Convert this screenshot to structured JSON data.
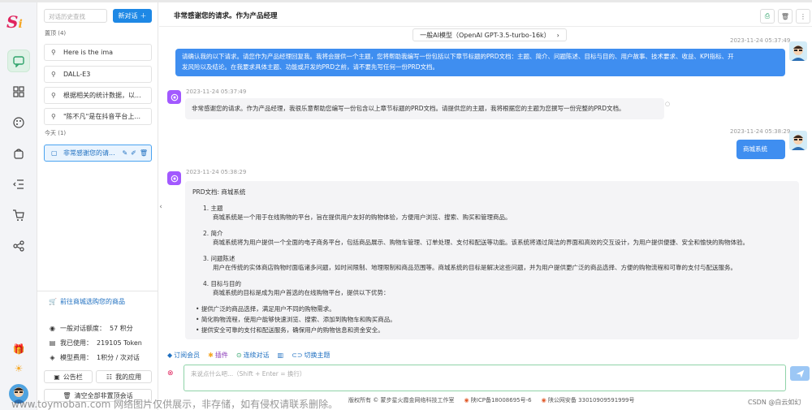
{
  "sidebar": {
    "search_placeholder": "对话历史查找",
    "new_chat_label": "新对话",
    "pinned_title": "置顶",
    "pinned_count": "(4)",
    "pinned_items": [
      "Here is the ima",
      "DALL-E3",
      "根据相关的统计数据，以...",
      "\"陈不凡\"是在抖音平台上..."
    ],
    "today_title": "今天",
    "today_count": "(1)",
    "today_items": [
      "非常感谢您的请..."
    ],
    "shop_link": "前往商城选购您的商品",
    "stats": {
      "quota_label": "一般对话额度：",
      "quota_value": "57 积分",
      "used_label": "我已使用：",
      "used_value": "219105 Token",
      "cost_label": "模型费用：",
      "cost_value": "1积分 / 次对话"
    },
    "notice_button": "公告栏",
    "my_apps_button": "我的应用",
    "clear_button": "清空全部非置顶会话"
  },
  "header": {
    "title": "非常感谢您的请求。作为产品经理"
  },
  "model": {
    "label": "一般AI模型（OpenAI GPT-3.5-turbo-16k）"
  },
  "messages": {
    "m1_time": "2023-11-24 05:37:49",
    "m1_text_line1": "请确认我的以下请求。请您作为产品经理回复我。我将会提供一个主题，您将帮助我编写一份包括以下章节标题的PRD文档：主题、简介、问题陈述、目标与目的、用户故事、技术要求、收益、KPI指标、开",
    "m1_text_line2": "发风险以及结论。在我要求具体主题、功能或开发的PRD之前，请不要先写任何一份PRD文档。",
    "m2_time": "2023-11-24 05:37:49",
    "m2_text": "非常感谢您的请求。作为产品经理，我很乐意帮助您编写一份包含以上章节标题的PRD文档。请提供您的主题，我将根据您的主题为您撰写一份完整的PRD文档。",
    "m3_time": "2023-11-24 05:38:29",
    "m3_text": "商城系统",
    "m4_time": "2023-11-24 05:38:29",
    "prd": {
      "heading": "PRD文档: 商城系统",
      "s1_title": "1. 主题",
      "s1_body": "商城系统是一个用于在线购物的平台，旨在提供用户友好的购物体验，方便用户浏览、搜索、购买和管理商品。",
      "s2_title": "2. 简介",
      "s2_body": "商城系统将为用户提供一个全面的电子商务平台，包括商品展示、购物车管理、订单处理、支付和配送等功能。该系统将通过简洁的界面和高效的交互设计，为用户提供便捷、安全和愉快的购物体验。",
      "s3_title": "3. 问题陈述",
      "s3_body": "用户在传统的实体商店购物时面临诸多问题，如时间限制、地理限制和商品范围等。商城系统的目标是解决这些问题，并为用户提供更广泛的商品选择、方便的购物流程和可靠的支付与配送服务。",
      "s4_title": "4. 目标与目的",
      "s4_body": "商城系统的目标是成为用户首选的在线购物平台，提供以下优势：",
      "bullets": [
        "提供广泛的商品选择，满足用户不同的购物需求。",
        "简化购物流程，使用户能够快速浏览、搜索、添加到购物车和购买商品。",
        "提供安全可靠的支付和配送服务，确保用户的购物信息和资金安全。"
      ]
    }
  },
  "tools": {
    "subscribe": "订阅会员",
    "plugins": "插件",
    "continuous": "连续对话",
    "switch_theme": "切换主题"
  },
  "input": {
    "placeholder": "来说点什么吧...（Shift + Enter = 换行）"
  },
  "footer": {
    "copyright": "版权所有 © 蒙步星火霞金网络科技工作室",
    "icp": "陕ICP备18008695号-6",
    "police": "陕公网安备 33010909591999号"
  },
  "watermark": "www.toymoban.com 网络图片仅供展示，非存储，如有侵权请联系删除。",
  "csdn": "CSDN @白云如幻",
  "colors": {
    "accent": "#1e88e5",
    "user_bubble": "#3f8ef0",
    "rail_active": "#dff2e6",
    "bot_icon": "#a259ff"
  }
}
